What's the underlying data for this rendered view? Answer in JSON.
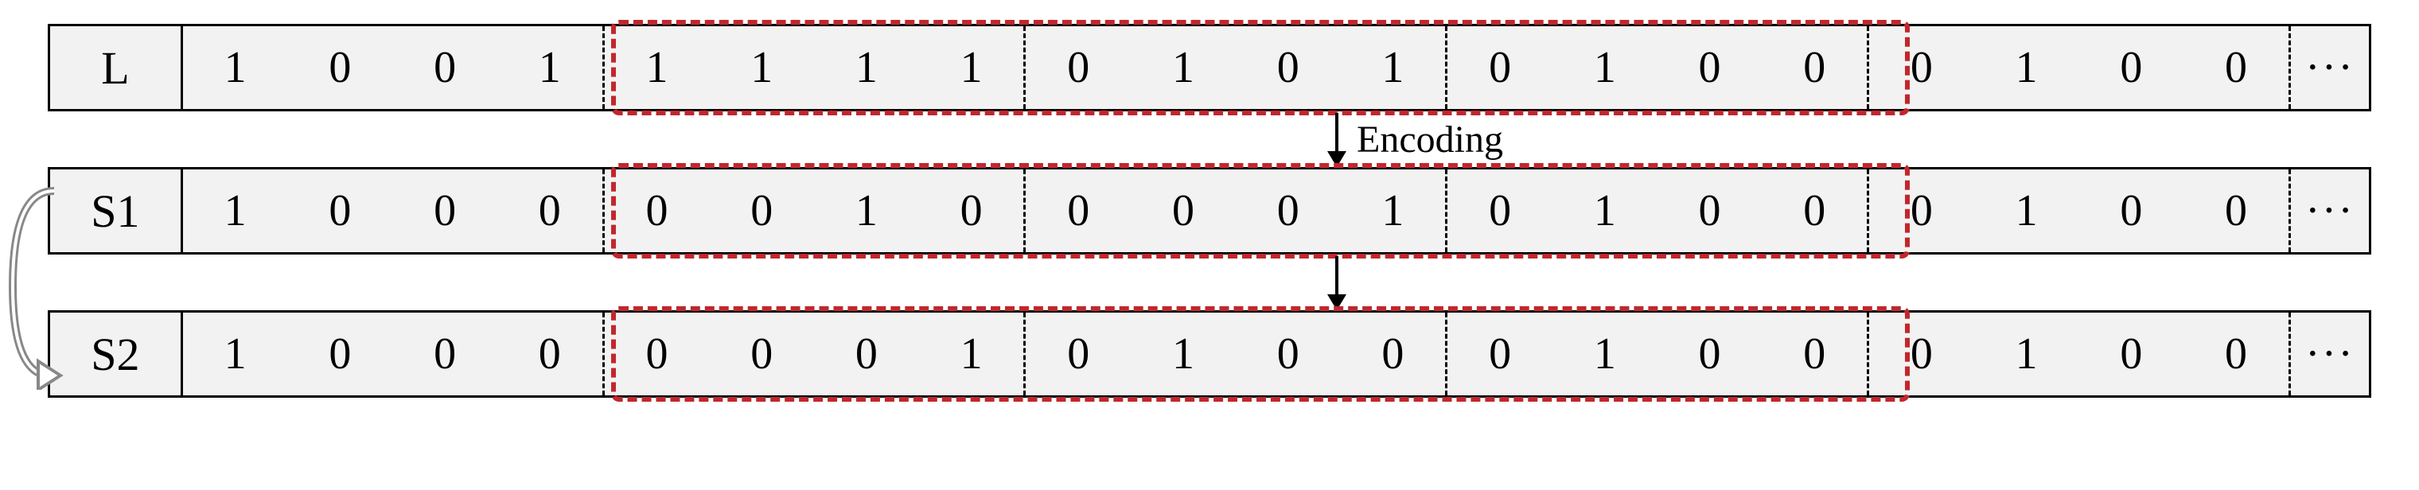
{
  "encoding_label": "Encoding",
  "rows": [
    {
      "label": "L",
      "groups": [
        [
          "1",
          "0",
          "0",
          "1"
        ],
        [
          "1",
          "1",
          "1",
          "1"
        ],
        [
          "0",
          "1",
          "0",
          "1"
        ],
        [
          "0",
          "1",
          "0",
          "0"
        ],
        [
          "0",
          "1",
          "0",
          "0"
        ]
      ],
      "ellipsis": "···"
    },
    {
      "label": "S1",
      "groups": [
        [
          "1",
          "0",
          "0",
          "0"
        ],
        [
          "0",
          "0",
          "1",
          "0"
        ],
        [
          "0",
          "0",
          "0",
          "1"
        ],
        [
          "0",
          "1",
          "0",
          "0"
        ],
        [
          "0",
          "1",
          "0",
          "0"
        ]
      ],
      "ellipsis": "···"
    },
    {
      "label": "S2",
      "groups": [
        [
          "1",
          "0",
          "0",
          "0"
        ],
        [
          "0",
          "0",
          "0",
          "1"
        ],
        [
          "0",
          "1",
          "0",
          "0"
        ],
        [
          "0",
          "1",
          "0",
          "0"
        ],
        [
          "0",
          "1",
          "0",
          "0"
        ]
      ],
      "ellipsis": "···"
    }
  ],
  "highlight_groups": [
    1,
    2,
    3
  ]
}
